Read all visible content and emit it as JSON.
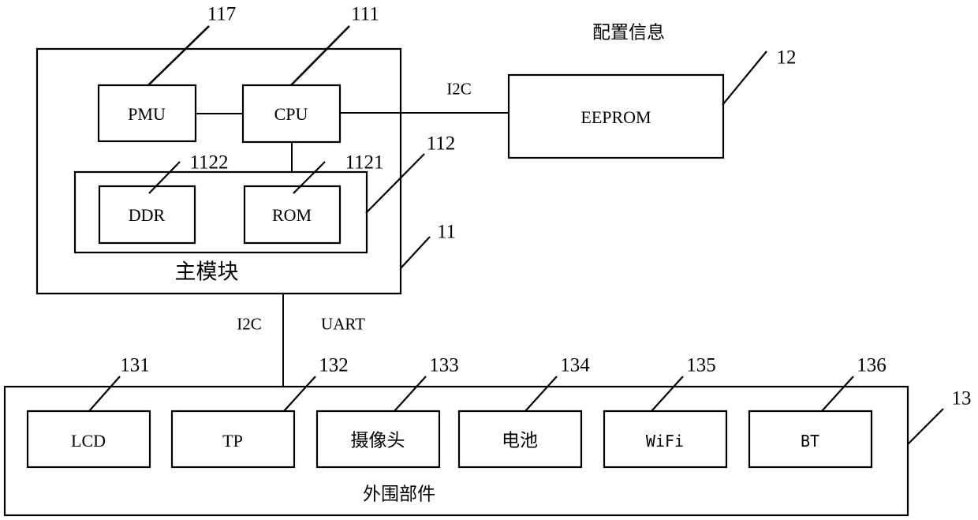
{
  "diagram": {
    "title_note": "配置信息",
    "blocks": {
      "pmu": {
        "label": "PMU",
        "ref": "117"
      },
      "cpu": {
        "label": "CPU",
        "ref": "111"
      },
      "ddr": {
        "label": "DDR",
        "ref": "1122"
      },
      "rom": {
        "label": "ROM",
        "ref": "1121"
      },
      "memory_group": {
        "ref": "112"
      },
      "main_module": {
        "label": "主模块",
        "ref": "11"
      },
      "eeprom": {
        "label": "EEPROM",
        "ref": "12"
      },
      "peripherals": {
        "label": "外围部件",
        "ref": "13"
      }
    },
    "buses": {
      "eeprom_bus": "I2C",
      "peripheral_bus_left": "I2C",
      "peripheral_bus_right": "UART"
    },
    "peripherals": [
      {
        "label": "LCD",
        "ref": "131"
      },
      {
        "label": "TP",
        "ref": "132"
      },
      {
        "label": "摄像头",
        "ref": "133"
      },
      {
        "label": "电池",
        "ref": "134"
      },
      {
        "label": "WiFi",
        "ref": "135"
      },
      {
        "label": "BT",
        "ref": "136"
      }
    ],
    "colors": {
      "stroke": "#000000",
      "background": "#ffffff",
      "text": "#000000"
    }
  }
}
